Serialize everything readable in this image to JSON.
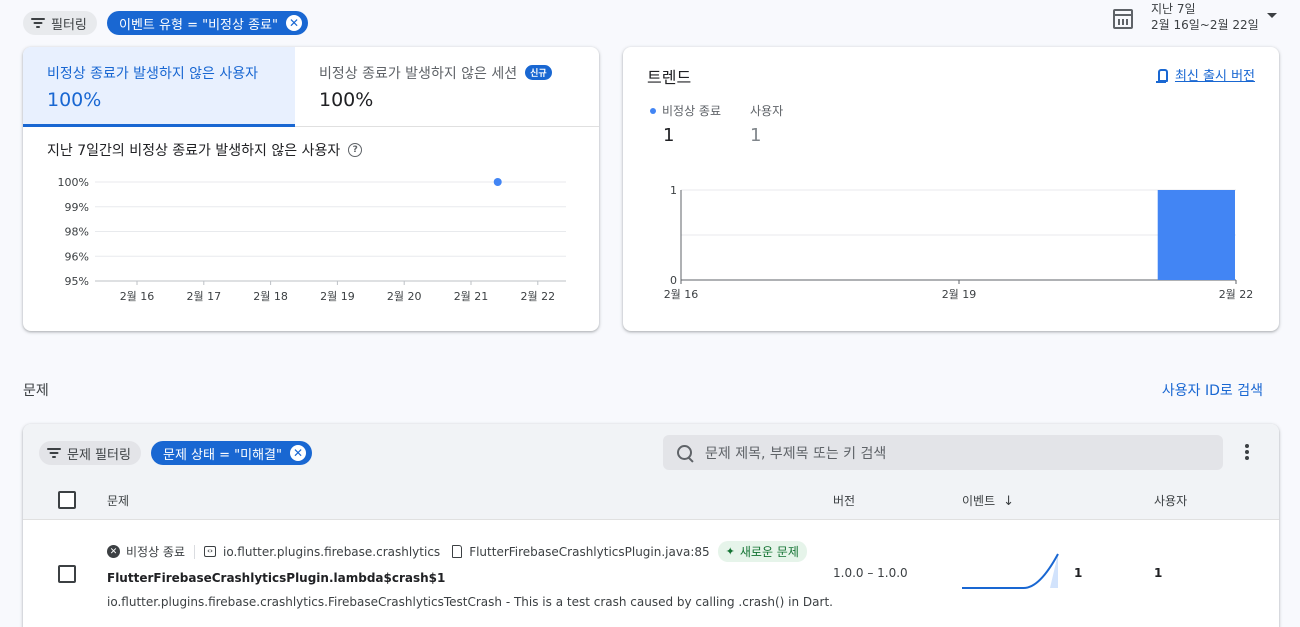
{
  "filters": {
    "filter_label": "필터링",
    "event_type_chip": "이벤트 유형 = \"비정상 종료\"",
    "chip_clear": "✕"
  },
  "date_range": {
    "label": "지난 7일",
    "range": "2월 16일~2월 22일"
  },
  "crash_free_card": {
    "tabs": [
      {
        "label": "비정상 종료가 발생하지 않은 사용자",
        "value": "100%"
      },
      {
        "label": "비정상 종료가 발생하지 않은 세션",
        "value": "100%",
        "badge": "신규"
      }
    ],
    "subtitle": "지난 7일간의 비정상 종료가 발생하지 않은 사용자",
    "help": "?"
  },
  "chart_data": [
    {
      "type": "line",
      "title": "지난 7일간의 비정상 종료가 발생하지 않은 사용자",
      "categories": [
        "2월 16",
        "2월 17",
        "2월 18",
        "2월 19",
        "2월 20",
        "2월 21",
        "2월 22"
      ],
      "y_ticks": [
        "100%",
        "99%",
        "98%",
        "96%",
        "95%"
      ],
      "ylim": [
        95,
        100
      ],
      "series": [
        {
          "points": [
            {
              "x": 5.4,
              "y": 100
            }
          ]
        }
      ],
      "grid": true,
      "color": "#4285f4"
    },
    {
      "type": "bar",
      "title": "트렌드",
      "categories": [
        "2월 16",
        "2월 19",
        "2월 22"
      ],
      "y_ticks": [
        "1",
        "0"
      ],
      "ylim": [
        0,
        1
      ],
      "series": [
        {
          "name": "비정상 종료",
          "values": [
            0,
            0,
            0,
            0,
            0,
            0,
            1
          ]
        }
      ],
      "color": "#4285f4"
    }
  ],
  "trend_card": {
    "title": "트렌드",
    "latest_link": "최신 출시 버전",
    "legend": [
      {
        "label": "비정상 종료",
        "value": "1"
      },
      {
        "label": "사용자",
        "value": "1"
      }
    ]
  },
  "issues": {
    "section_title": "문제",
    "search_by_id": "사용자 ID로 검색",
    "filter_label": "문제 필터링",
    "status_chip": "문제 상태 = \"미해결\"",
    "search_placeholder": "문제 제목, 부제목 또는 키 검색",
    "columns": {
      "issue": "문제",
      "version": "버전",
      "events": "이벤트",
      "events_sort": "↓",
      "users": "사용자"
    },
    "rows": [
      {
        "type": "비정상 종료",
        "package": "io.flutter.plugins.firebase.crashlytics",
        "file": "FlutterFirebaseCrashlyticsPlugin.java:85",
        "badge": "새로운 문제",
        "title": "FlutterFirebaseCrashlyticsPlugin.lambda$crash$1",
        "subtitle": "io.flutter.plugins.firebase.crashlytics.FirebaseCrashlyticsTestCrash - This is a test crash caused by calling .crash() in Dart.",
        "version": "1.0.0 – 1.0.0",
        "events": "1",
        "users": "1",
        "sparkline": [
          0,
          0,
          0,
          0,
          0,
          0,
          1
        ]
      }
    ]
  }
}
